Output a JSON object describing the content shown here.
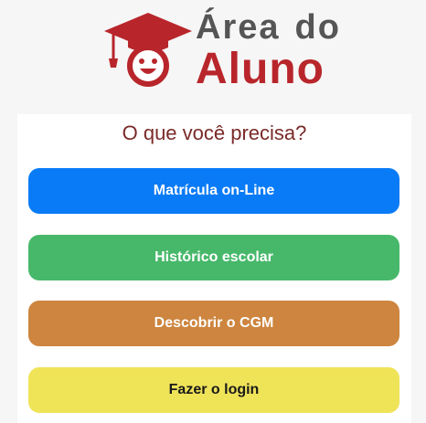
{
  "logo": {
    "line1_word1": "Área",
    "line1_word2": "do",
    "line2": "Aluno",
    "icon": "graduation-student-icon"
  },
  "panel": {
    "question": "O que você precisa?"
  },
  "buttons": [
    {
      "label": "Matrícula on-Line",
      "color": "#0a7bf6"
    },
    {
      "label": "Histórico escolar",
      "color": "#47b86a"
    },
    {
      "label": "Descobrir o CGM",
      "color": "#cd853f"
    },
    {
      "label": "Fazer o login",
      "color": "#efe358"
    }
  ],
  "colors": {
    "brand_red": "#b8262b",
    "logo_gray": "#555555",
    "question_text": "#7a2a28"
  }
}
